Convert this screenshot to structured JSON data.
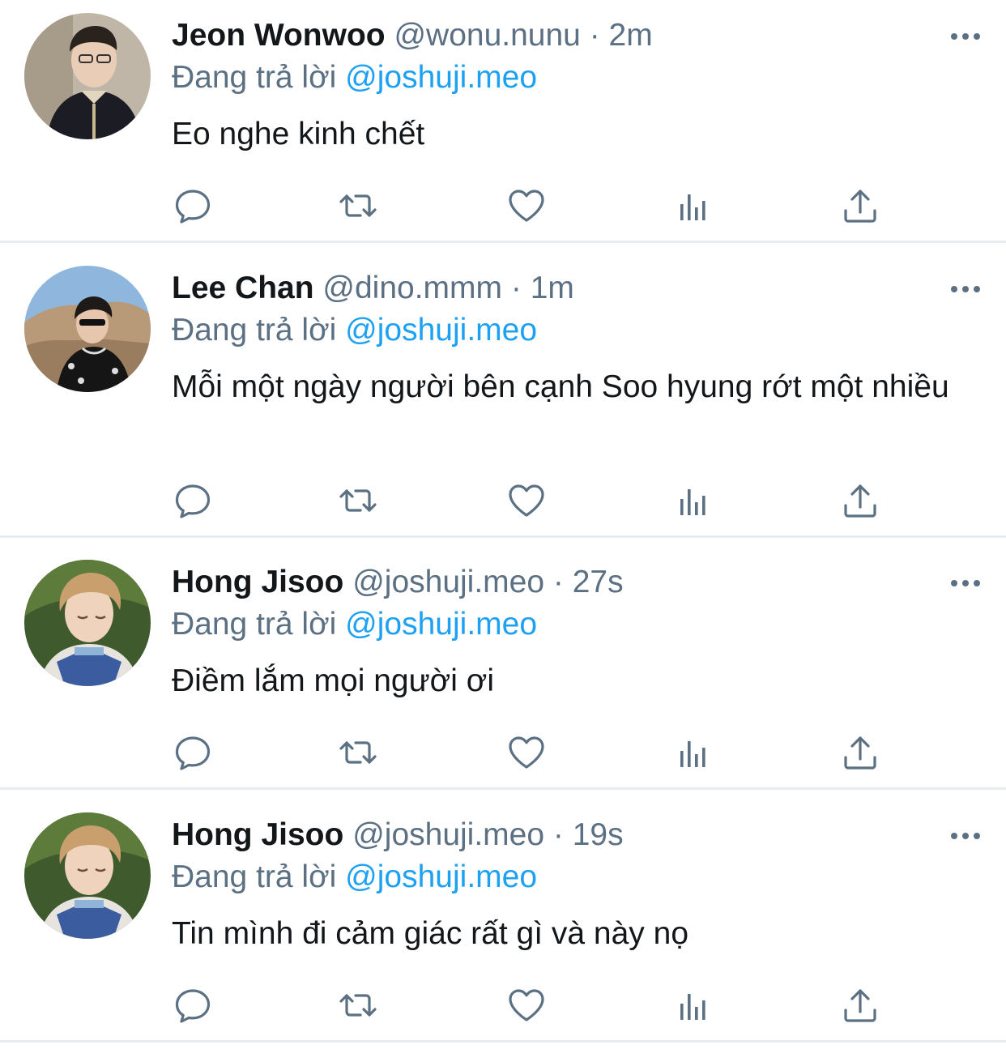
{
  "colors": {
    "text_primary": "#14171a",
    "text_secondary": "#5b7083",
    "link": "#1da1f2",
    "divider": "#e6ecf0",
    "icon": "#5b7083"
  },
  "tweets": [
    {
      "name": "Jeon Wonwoo",
      "handle": "@wonu.nunu",
      "separator": "·",
      "time": "2m",
      "reply_prefix": "Đang trả lời",
      "reply_to": "@joshuji.meo",
      "text": "Eo nghe kinh chết",
      "icons": [
        "reply-icon",
        "retweet-icon",
        "like-icon",
        "analytics-icon",
        "share-icon",
        "more-icon"
      ]
    },
    {
      "name": "Lee Chan",
      "handle": "@dino.mmm",
      "separator": "·",
      "time": "1m",
      "reply_prefix": "Đang trả lời",
      "reply_to": "@joshuji.meo",
      "text": "Mỗi một ngày người bên cạnh Soo hyung rớt một nhiều",
      "icons": [
        "reply-icon",
        "retweet-icon",
        "like-icon",
        "analytics-icon",
        "share-icon",
        "more-icon"
      ]
    },
    {
      "name": "Hong Jisoo",
      "handle": "@joshuji.meo",
      "separator": "·",
      "time": "27s",
      "reply_prefix": "Đang trả lời",
      "reply_to": "@joshuji.meo",
      "text": "Điềm lắm mọi người ơi",
      "icons": [
        "reply-icon",
        "retweet-icon",
        "like-icon",
        "analytics-icon",
        "share-icon",
        "more-icon"
      ]
    },
    {
      "name": "Hong Jisoo",
      "handle": "@joshuji.meo",
      "separator": "·",
      "time": "19s",
      "reply_prefix": "Đang trả lời",
      "reply_to": "@joshuji.meo",
      "text": "Tin mình đi cảm giác rất gì và này nọ",
      "icons": [
        "reply-icon",
        "retweet-icon",
        "like-icon",
        "analytics-icon",
        "share-icon",
        "more-icon"
      ]
    }
  ]
}
